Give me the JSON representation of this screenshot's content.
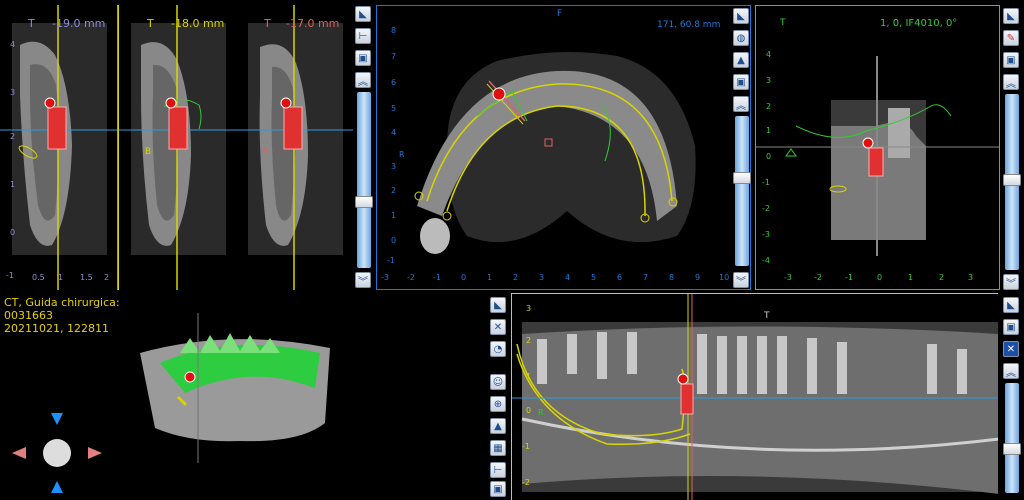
{
  "cross_sections": [
    {
      "label": "T",
      "value": "-19.0 mm",
      "color": "#8f8cd6",
      "sub": ""
    },
    {
      "label": "T",
      "value": "-18.0 mm",
      "color": "#d8d400",
      "sub": "B"
    },
    {
      "label": "T",
      "value": "-17.0 mm",
      "color": "#e06060",
      "sub": "B"
    }
  ],
  "left_axis_ticks": [
    "4",
    "3",
    "2",
    "1",
    "0",
    "-1"
  ],
  "bottom_ticks": [
    "0.5",
    "1",
    "1.5",
    "2"
  ],
  "axial": {
    "top_label": "F",
    "measure": "171, 60.8 mm",
    "side_label": "R",
    "ticks_x": [
      "-3",
      "-2",
      "-1",
      "0",
      "1",
      "2",
      "3",
      "4",
      "5",
      "6",
      "7",
      "8",
      "9",
      "10"
    ],
    "ticks_y": [
      "8",
      "7",
      "6",
      "5",
      "4",
      "3",
      "2",
      "1",
      "0",
      "-1"
    ]
  },
  "tangential": {
    "label": "T",
    "info": "1, 0, IF4010, 0°",
    "ticks_x": [
      "-3",
      "-2",
      "-1",
      "0",
      "1",
      "2",
      "3"
    ],
    "ticks_y": [
      "4",
      "3",
      "2",
      "1",
      "0",
      "-1",
      "-2",
      "-3",
      "-4"
    ]
  },
  "info": {
    "line1": "CT, Guida chirurgica:",
    "line2": "0031663",
    "line3": "20211021, 122811"
  },
  "panoramic": {
    "top_label": "T",
    "side_label": "R",
    "ticks_y": [
      "3",
      "2",
      "1",
      "0",
      "-1",
      "-2"
    ]
  },
  "colors": {
    "cs1": "#8f8cd6",
    "cs2": "#d8d400",
    "cs3": "#e06060",
    "axial": "#1e78d8",
    "tangential": "#33cc33",
    "pano": "#d8d400"
  }
}
